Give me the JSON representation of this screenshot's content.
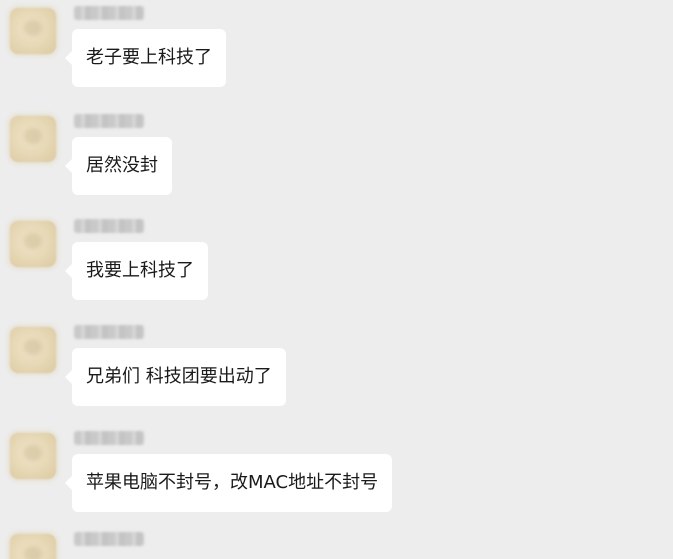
{
  "chat": {
    "messages": [
      {
        "sender": "",
        "text": "老子要上科技了"
      },
      {
        "sender": "",
        "text": "居然没封"
      },
      {
        "sender": "",
        "text": "我要上科技了"
      },
      {
        "sender": "",
        "text": "兄弟们 科技团要出动了"
      },
      {
        "sender": "",
        "text": "苹果电脑不封号，改MAC地址不封号"
      },
      {
        "sender": "",
        "text": ""
      }
    ]
  },
  "colors": {
    "background": "#ededed",
    "bubble": "#ffffff",
    "text": "#1a1a1a"
  }
}
